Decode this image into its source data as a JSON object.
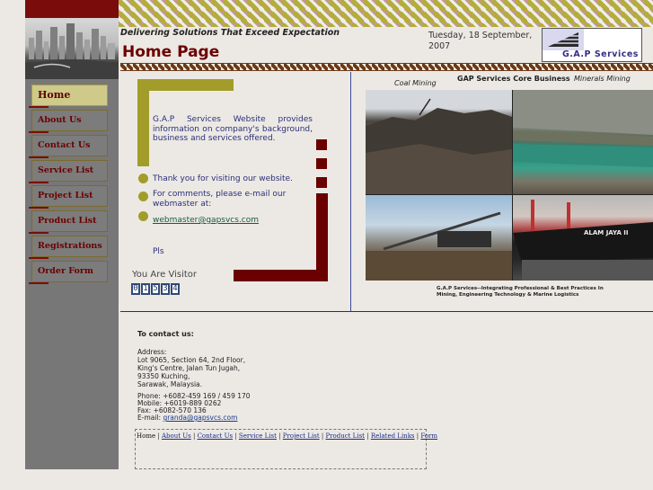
{
  "header": {
    "tagline": "Delivering Solutions That Exceed Expectation",
    "page_title": "Home Page",
    "date": "Tuesday, 18 September, 2007",
    "logo_text": "G.A.P Services"
  },
  "nav": {
    "items": [
      {
        "label": "Home"
      },
      {
        "label": "About Us"
      },
      {
        "label": "Contact Us"
      },
      {
        "label": "Service List"
      },
      {
        "label": "Project List"
      },
      {
        "label": "Product List"
      },
      {
        "label": "Registrations"
      },
      {
        "label": "Order Form"
      }
    ]
  },
  "intro": {
    "text": "G.A.P Services Website provides information on company's background, business and services offered.",
    "thanks": "Thank you for visiting our website.",
    "comments": "For comments, please e-mail our webmaster at:",
    "email": "webmaster@gapsvcs.com",
    "pls": "Pls",
    "visitor_label": "You Are Visitor",
    "visitor_count": [
      "0",
      "1",
      "5",
      "3",
      "4"
    ]
  },
  "photos": {
    "caption_coal": "Coal Mining",
    "caption_core": "GAP Services Core Business",
    "caption_minerals": "Minerals Mining",
    "ship_name": "ALAM JAYA II",
    "bottom_caption": "G.A.P Services--Integrating Professional & Best Practices In Mining, Engineering Technology & Marine Logistics"
  },
  "contact": {
    "heading": "To contact us:",
    "address_label": "Address:",
    "address_lines": [
      "Lot 9065, Section 64, 2nd Floor,",
      "King's Centre, Jalan Tun Jugah,",
      "93350 Kuching,",
      "Sarawak, Malaysia."
    ],
    "phone": "Phone: +6082-459 169 / 459  170",
    "mobile": "Mobile: +6019-889 0262",
    "fax": "Fax: +6082-570  136",
    "email_label": "E-mail:",
    "email": "granda@gapsvcs.com"
  },
  "footer": {
    "links": [
      "Home",
      "About Us",
      "Contact Us",
      "Service List",
      "Project List",
      "Product List",
      "Related Links",
      "Form"
    ]
  },
  "colors": {
    "maroon": "#6a0000",
    "olive": "#a29c2a",
    "nav_active": "#cfc98a",
    "left_column": "#777777",
    "body_text": "#2b2e7a"
  }
}
